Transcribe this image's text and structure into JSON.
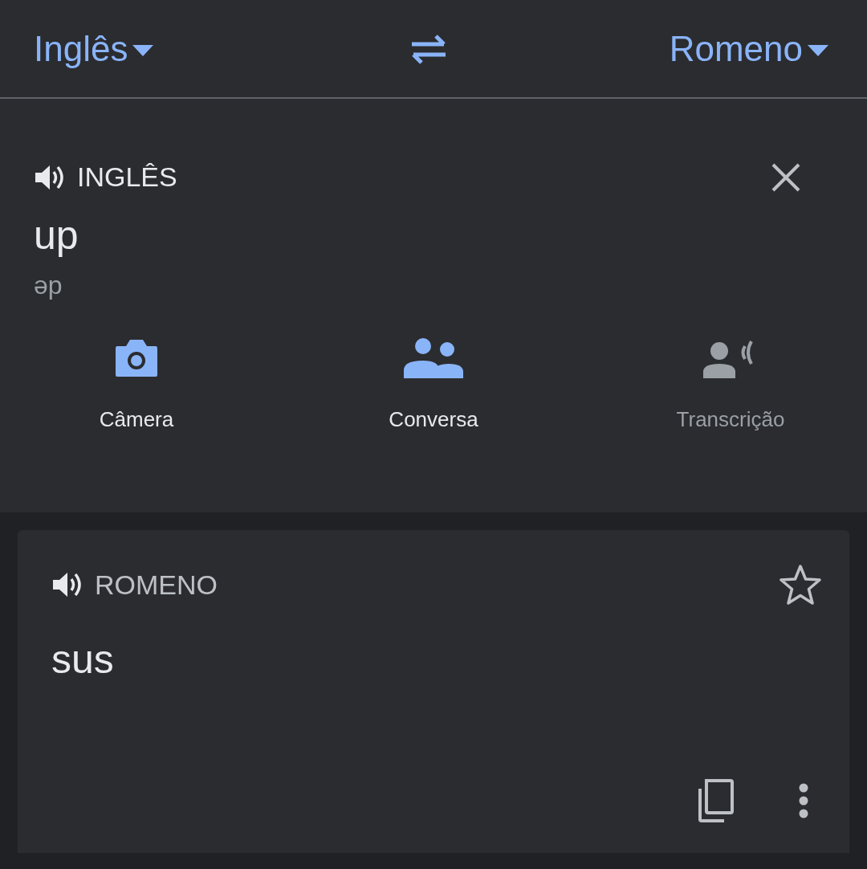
{
  "language_bar": {
    "source": "Inglês",
    "target": "Romeno"
  },
  "input": {
    "language": "INGLÊS",
    "text": "up",
    "transliteration": "əp"
  },
  "tools": [
    {
      "kind": "camera",
      "label": "Câmera",
      "disabled": false
    },
    {
      "kind": "conversation",
      "label": "Conversa",
      "disabled": false
    },
    {
      "kind": "transcribe",
      "label": "Transcrição",
      "disabled": true
    }
  ],
  "output": {
    "language": "ROMENO",
    "text": "sus",
    "starred": false
  }
}
